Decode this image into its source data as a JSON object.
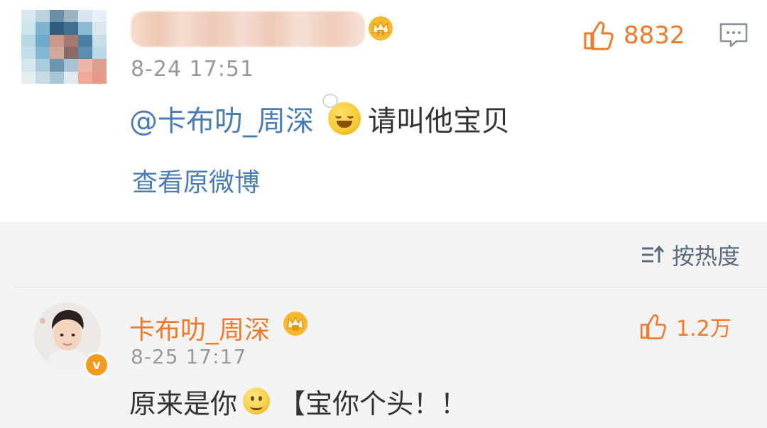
{
  "comment": {
    "time": "8-24 17:51",
    "likes": "8832",
    "mention": "@卡布叻_周深",
    "text": "请叫他宝贝",
    "view_original": "查看原微博",
    "icons": [
      "crown-badge-icon",
      "thumbs-up-icon",
      "comment-icon",
      "emoji-icon"
    ]
  },
  "sort": {
    "label": "按热度",
    "icon": "sort-icon"
  },
  "reply": {
    "name": "卡布叻_周深",
    "time": "8-25 17:17",
    "likes": "1.2万",
    "text_before": "原来是你",
    "text_after": "【宝你个头！！",
    "icons": [
      "crown-badge-icon",
      "thumbs-up-icon",
      "verified-v-icon",
      "smile-emoji-icon"
    ]
  },
  "colors": {
    "accent_orange": "#f07a2a",
    "link_blue": "#4a7db5",
    "text_gray": "#999999",
    "body_text": "#333333",
    "bottom_bg": "#f3f3f3"
  }
}
